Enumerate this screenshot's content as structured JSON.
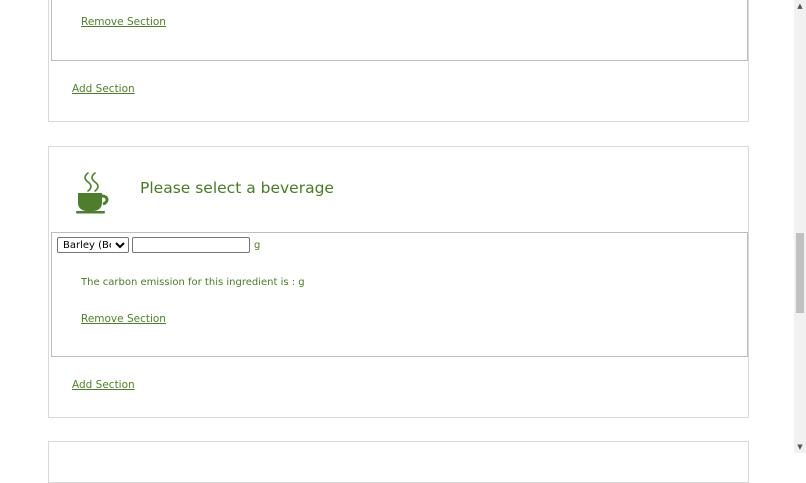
{
  "section_top": {
    "remove_label": "Remove Section",
    "add_label": "Add Section"
  },
  "section_beverage": {
    "title": "Please select a beverage",
    "icon": "coffee-cup-icon",
    "ingredient_select": {
      "selected": "Barley (Beer)",
      "options": [
        "Barley (Beer)"
      ]
    },
    "quantity": {
      "value": "",
      "placeholder": ""
    },
    "unit": "g",
    "emission_text": "The carbon emission for this ingredient is : g",
    "remove_label": "Remove Section",
    "add_label": "Add Section"
  },
  "colors": {
    "accent": "#4c7a2c",
    "icon": "#4e7d2e",
    "border": "#bdbdbd"
  },
  "scrollbar": {
    "thumb_color": "#c1c1c1",
    "up_icon": "triangle-up-icon",
    "down_icon": "triangle-down-icon"
  }
}
